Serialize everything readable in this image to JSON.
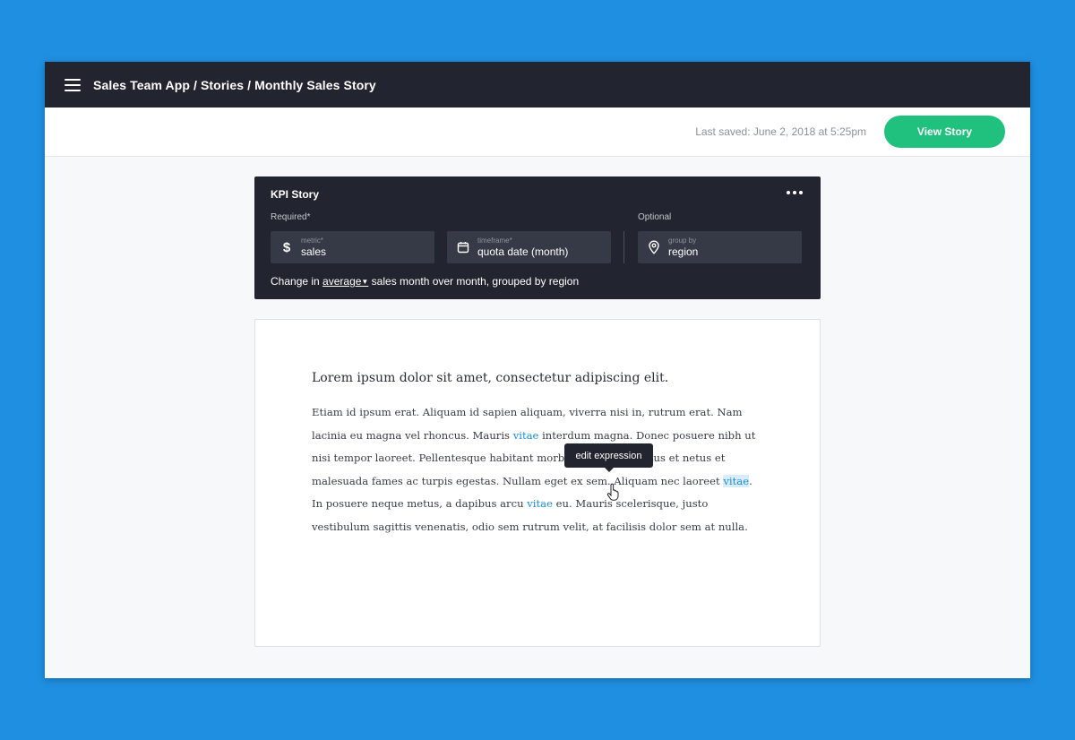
{
  "header": {
    "breadcrumb": "Sales Team App / Stories / Monthly Sales Story",
    "menu_icon": "hamburger-icon"
  },
  "toolbar": {
    "last_saved": "Last saved: June 2, 2018 at 5:25pm",
    "view_story_label": "View Story",
    "accent": "#20c17e"
  },
  "kpi": {
    "title": "KPI Story",
    "required_label": "Required*",
    "optional_label": "Optional",
    "metric": {
      "label": "metric*",
      "value": "sales",
      "icon": "dollar-icon"
    },
    "timeframe": {
      "label": "timeframe*",
      "value": "quota date (month)",
      "icon": "calendar-icon"
    },
    "group_by": {
      "label": "group by",
      "value": "region",
      "icon": "location-pin-icon"
    },
    "sentence_prefix": "Change in ",
    "aggregation": "average",
    "sentence_suffix": " sales month over month, grouped by region"
  },
  "story": {
    "heading": "Lorem ipsum dolor sit amet, consectetur adipiscing elit.",
    "p1": "Etiam id ipsum erat. Aliquam id sapien aliquam, viverra nisi in, rutrum erat. Nam lacinia eu magna vel rhoncus. Mauris ",
    "expr1": "vitae",
    "p2": " interdum magna. Donec posuere nibh ut nisi tempor laoreet. Pellentesque habitant morbi tristique senectus et netus et malesuada fames ac turpis egestas. Nullam eget ex sem. Aliquam nec laoreet ",
    "expr2": "vitae",
    "p3": ". In posuere neque metus, a dapibus arcu ",
    "expr3": "vitae",
    "p4": " eu. Mauris scelerisque, justo vestibulum sagittis venenatis, odio sem rutrum velit, at facilisis dolor sem at nulla.",
    "expression_color": "#1b8fd9"
  },
  "tooltip": {
    "text": "edit expression"
  }
}
